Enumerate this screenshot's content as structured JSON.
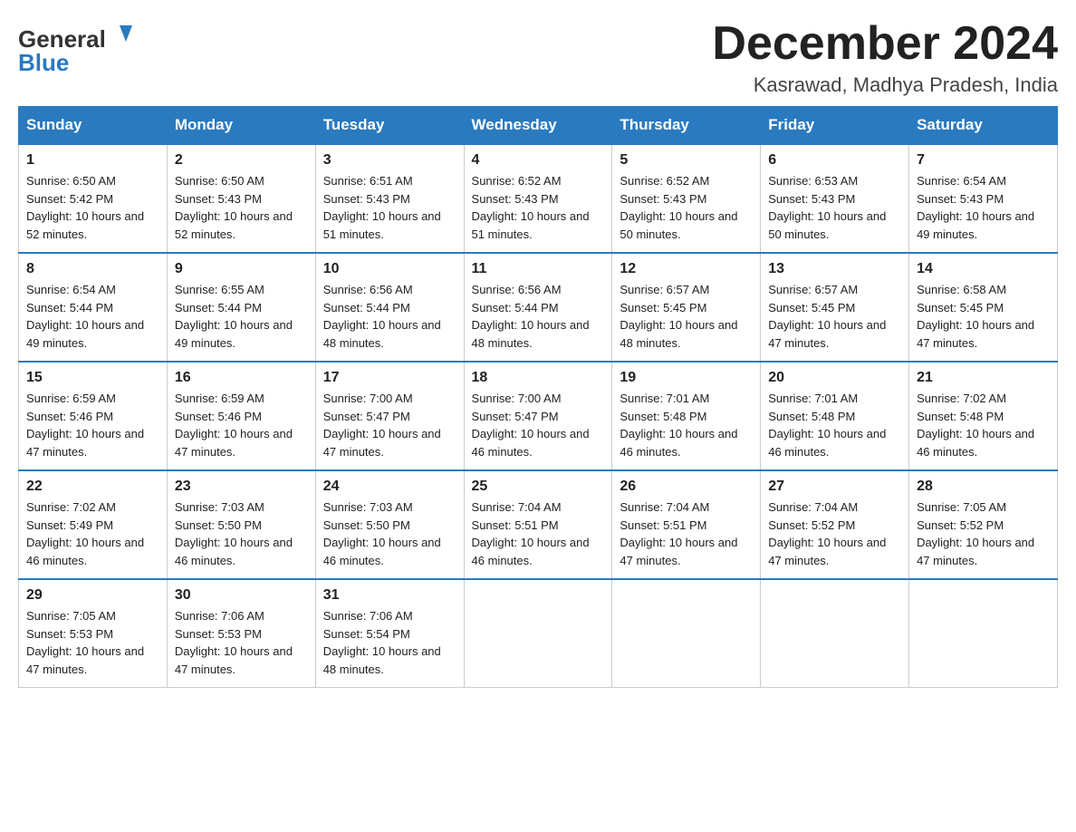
{
  "header": {
    "logo_general": "General",
    "logo_blue": "Blue",
    "month_title": "December 2024",
    "location": "Kasrawad, Madhya Pradesh, India"
  },
  "days_of_week": [
    "Sunday",
    "Monday",
    "Tuesday",
    "Wednesday",
    "Thursday",
    "Friday",
    "Saturday"
  ],
  "weeks": [
    [
      {
        "day": "1",
        "sunrise": "6:50 AM",
        "sunset": "5:42 PM",
        "daylight": "10 hours and 52 minutes."
      },
      {
        "day": "2",
        "sunrise": "6:50 AM",
        "sunset": "5:43 PM",
        "daylight": "10 hours and 52 minutes."
      },
      {
        "day": "3",
        "sunrise": "6:51 AM",
        "sunset": "5:43 PM",
        "daylight": "10 hours and 51 minutes."
      },
      {
        "day": "4",
        "sunrise": "6:52 AM",
        "sunset": "5:43 PM",
        "daylight": "10 hours and 51 minutes."
      },
      {
        "day": "5",
        "sunrise": "6:52 AM",
        "sunset": "5:43 PM",
        "daylight": "10 hours and 50 minutes."
      },
      {
        "day": "6",
        "sunrise": "6:53 AM",
        "sunset": "5:43 PM",
        "daylight": "10 hours and 50 minutes."
      },
      {
        "day": "7",
        "sunrise": "6:54 AM",
        "sunset": "5:43 PM",
        "daylight": "10 hours and 49 minutes."
      }
    ],
    [
      {
        "day": "8",
        "sunrise": "6:54 AM",
        "sunset": "5:44 PM",
        "daylight": "10 hours and 49 minutes."
      },
      {
        "day": "9",
        "sunrise": "6:55 AM",
        "sunset": "5:44 PM",
        "daylight": "10 hours and 49 minutes."
      },
      {
        "day": "10",
        "sunrise": "6:56 AM",
        "sunset": "5:44 PM",
        "daylight": "10 hours and 48 minutes."
      },
      {
        "day": "11",
        "sunrise": "6:56 AM",
        "sunset": "5:44 PM",
        "daylight": "10 hours and 48 minutes."
      },
      {
        "day": "12",
        "sunrise": "6:57 AM",
        "sunset": "5:45 PM",
        "daylight": "10 hours and 48 minutes."
      },
      {
        "day": "13",
        "sunrise": "6:57 AM",
        "sunset": "5:45 PM",
        "daylight": "10 hours and 47 minutes."
      },
      {
        "day": "14",
        "sunrise": "6:58 AM",
        "sunset": "5:45 PM",
        "daylight": "10 hours and 47 minutes."
      }
    ],
    [
      {
        "day": "15",
        "sunrise": "6:59 AM",
        "sunset": "5:46 PM",
        "daylight": "10 hours and 47 minutes."
      },
      {
        "day": "16",
        "sunrise": "6:59 AM",
        "sunset": "5:46 PM",
        "daylight": "10 hours and 47 minutes."
      },
      {
        "day": "17",
        "sunrise": "7:00 AM",
        "sunset": "5:47 PM",
        "daylight": "10 hours and 47 minutes."
      },
      {
        "day": "18",
        "sunrise": "7:00 AM",
        "sunset": "5:47 PM",
        "daylight": "10 hours and 46 minutes."
      },
      {
        "day": "19",
        "sunrise": "7:01 AM",
        "sunset": "5:48 PM",
        "daylight": "10 hours and 46 minutes."
      },
      {
        "day": "20",
        "sunrise": "7:01 AM",
        "sunset": "5:48 PM",
        "daylight": "10 hours and 46 minutes."
      },
      {
        "day": "21",
        "sunrise": "7:02 AM",
        "sunset": "5:48 PM",
        "daylight": "10 hours and 46 minutes."
      }
    ],
    [
      {
        "day": "22",
        "sunrise": "7:02 AM",
        "sunset": "5:49 PM",
        "daylight": "10 hours and 46 minutes."
      },
      {
        "day": "23",
        "sunrise": "7:03 AM",
        "sunset": "5:50 PM",
        "daylight": "10 hours and 46 minutes."
      },
      {
        "day": "24",
        "sunrise": "7:03 AM",
        "sunset": "5:50 PM",
        "daylight": "10 hours and 46 minutes."
      },
      {
        "day": "25",
        "sunrise": "7:04 AM",
        "sunset": "5:51 PM",
        "daylight": "10 hours and 46 minutes."
      },
      {
        "day": "26",
        "sunrise": "7:04 AM",
        "sunset": "5:51 PM",
        "daylight": "10 hours and 47 minutes."
      },
      {
        "day": "27",
        "sunrise": "7:04 AM",
        "sunset": "5:52 PM",
        "daylight": "10 hours and 47 minutes."
      },
      {
        "day": "28",
        "sunrise": "7:05 AM",
        "sunset": "5:52 PM",
        "daylight": "10 hours and 47 minutes."
      }
    ],
    [
      {
        "day": "29",
        "sunrise": "7:05 AM",
        "sunset": "5:53 PM",
        "daylight": "10 hours and 47 minutes."
      },
      {
        "day": "30",
        "sunrise": "7:06 AM",
        "sunset": "5:53 PM",
        "daylight": "10 hours and 47 minutes."
      },
      {
        "day": "31",
        "sunrise": "7:06 AM",
        "sunset": "5:54 PM",
        "daylight": "10 hours and 48 minutes."
      },
      null,
      null,
      null,
      null
    ]
  ],
  "labels": {
    "sunrise": "Sunrise:",
    "sunset": "Sunset:",
    "daylight": "Daylight:"
  }
}
